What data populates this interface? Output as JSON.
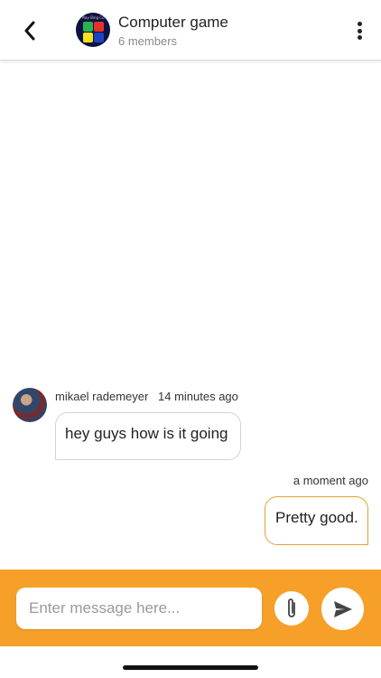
{
  "header": {
    "back_icon": "chevron-left-icon",
    "group_title": "Computer game",
    "group_subtitle": "6 members",
    "avatar_caption": "Play Bing Co",
    "more_icon": "more-vertical-icon"
  },
  "messages": [
    {
      "direction": "incoming",
      "sender": "mikael rademeyer",
      "time": "14 minutes ago",
      "text": "hey guys how is it going"
    },
    {
      "direction": "outgoing",
      "sender": "",
      "time": "a moment ago",
      "text": "Pretty good."
    }
  ],
  "composer": {
    "placeholder": "Enter message here...",
    "value": "",
    "attach_icon": "paperclip-icon",
    "send_icon": "send-icon"
  },
  "colors": {
    "accent": "#f6a02a",
    "outgoing_border": "#e0a331",
    "incoming_border": "#d2d2d2"
  }
}
